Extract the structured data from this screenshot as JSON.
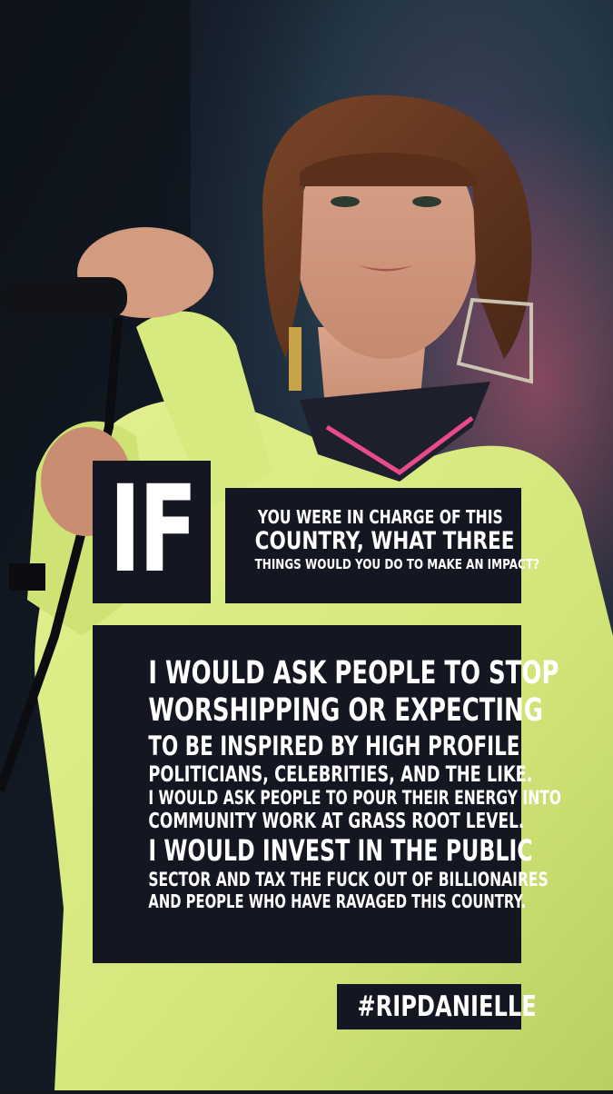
{
  "photo": {
    "description_icon": "singer-photo",
    "colors": {
      "outfit": "#d9ec86",
      "background": "#1d2a3a",
      "hair": "#6b3a22"
    }
  },
  "if_label": "IF",
  "question": {
    "line1": "YOU WERE IN CHARGE OF THIS",
    "line2": "COUNTRY, WHAT THREE",
    "line3": "THINGS WOULD YOU DO TO MAKE AN IMPACT?"
  },
  "answer": {
    "lines": [
      "I WOULD ASK PEOPLE TO STOP",
      "WORSHIPPING OR EXPECTING",
      "TO BE INSPIRED BY HIGH PROFILE",
      "POLITICIANS, CELEBRITIES, AND THE LIKE.",
      "I WOULD ASK PEOPLE TO POUR THEIR ENERGY INTO",
      "COMMUNITY WORK AT GRASS ROOT LEVEL.",
      "I WOULD INVEST IN THE PUBLIC",
      "SECTOR AND TAX THE FUCK OUT OF BILLIONAIRES",
      "AND PEOPLE WHO HAVE RAVAGED THIS COUNTRY."
    ]
  },
  "hashtag": "#RIPDANIELLE",
  "colors": {
    "box_bg": "#141622",
    "text": "#ffffff"
  }
}
